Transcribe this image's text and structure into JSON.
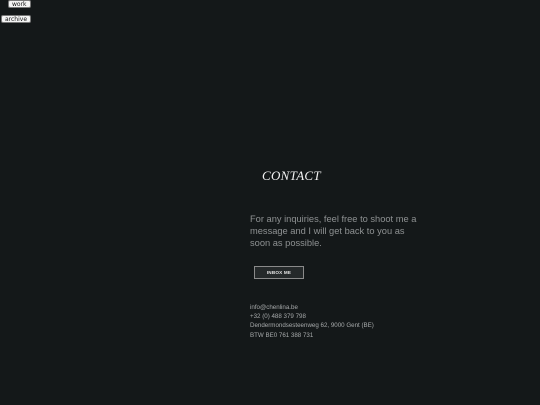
{
  "nav": {
    "work_label": "work",
    "archive_label": "archive",
    "links": [
      "",
      "",
      ""
    ]
  },
  "contact": {
    "title": "CONTACT",
    "intro": "For any inquiries, feel free to shoot me a message and I will get back to you as soon as possible.",
    "button_label": "INBOX ME",
    "email": "info@chenlina.be",
    "phone": "+32 (0) 488 379 798",
    "address": "Dendermondsesteenweg 62, 9000 Gent (BE)",
    "vat": "BTW BE0 761 388 731"
  }
}
